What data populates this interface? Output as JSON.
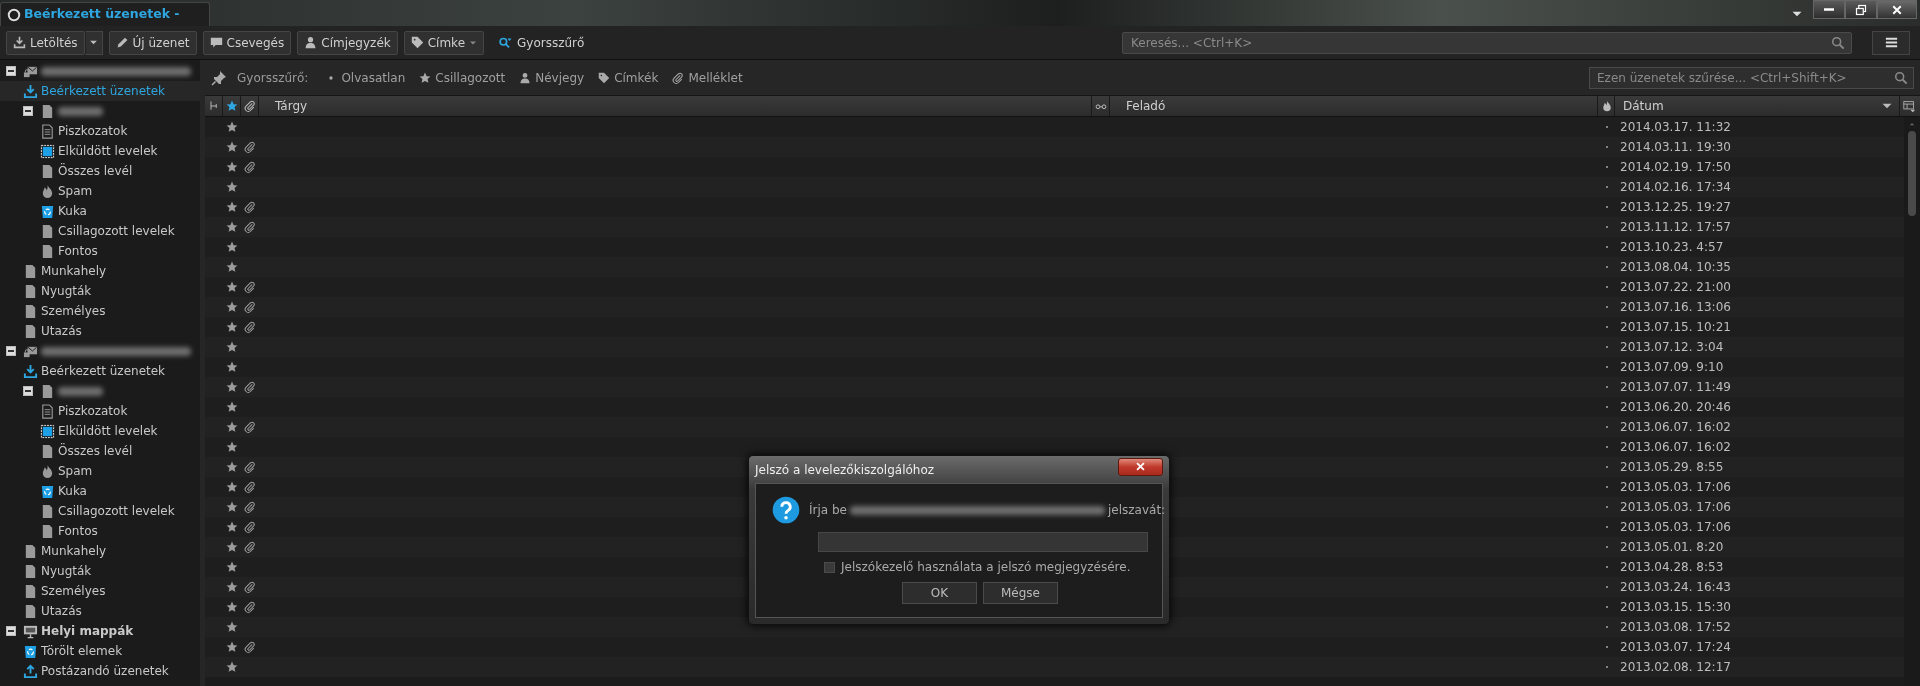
{
  "window": {
    "tab_title": "Beérkezett üzenetek -"
  },
  "toolbar": {
    "buttons": [
      {
        "label": "Letöltés",
        "kind": "split"
      },
      {
        "label": "Új üzenet",
        "kind": "button"
      },
      {
        "label": "Csevegés",
        "kind": "button"
      },
      {
        "label": "Címjegyzék",
        "kind": "button"
      },
      {
        "label": "Címke",
        "kind": "menu"
      },
      {
        "label": "Gyorsszűrő",
        "kind": "flat"
      }
    ],
    "search": {
      "placeholder": "Keresés... <Ctrl+K>"
    }
  },
  "folders": [
    {
      "kind": "account",
      "selected": false,
      "expanded": true,
      "children": [
        {
          "kind": "inbox",
          "label": "Beérkezett üzenetek",
          "selected": true
        },
        {
          "kind": "folder",
          "selected": false,
          "expanded": true,
          "children": [
            {
              "kind": "drafts",
              "label": "Piszkozatok",
              "selected": false
            },
            {
              "kind": "sent",
              "label": "Elküldött levelek",
              "selected": false
            },
            {
              "kind": "folder",
              "label": "Összes levél",
              "selected": false
            },
            {
              "kind": "spam",
              "label": "Spam",
              "selected": false
            },
            {
              "kind": "trash",
              "label": "Kuka",
              "selected": false
            },
            {
              "kind": "folder",
              "label": "Csillagozott levelek",
              "selected": false
            },
            {
              "kind": "folder",
              "label": "Fontos",
              "selected": false
            }
          ]
        },
        {
          "kind": "folder",
          "label": "Munkahely",
          "selected": false
        },
        {
          "kind": "folder",
          "label": "Nyugták",
          "selected": false
        },
        {
          "kind": "folder",
          "label": "Személyes",
          "selected": false
        },
        {
          "kind": "folder",
          "label": "Utazás",
          "selected": false
        }
      ]
    },
    {
      "kind": "account",
      "selected": false,
      "expanded": true,
      "children": [
        {
          "kind": "inbox",
          "label": "Beérkezett üzenetek",
          "selected": false
        },
        {
          "kind": "folder",
          "selected": false,
          "expanded": true,
          "children": [
            {
              "kind": "drafts",
              "label": "Piszkozatok",
              "selected": false
            },
            {
              "kind": "sent",
              "label": "Elküldött levelek",
              "selected": false
            },
            {
              "kind": "folder",
              "label": "Összes levél",
              "selected": false
            },
            {
              "kind": "spam",
              "label": "Spam",
              "selected": false
            },
            {
              "kind": "trash",
              "label": "Kuka",
              "selected": false
            },
            {
              "kind": "folder",
              "label": "Csillagozott levelek",
              "selected": false
            },
            {
              "kind": "folder",
              "label": "Fontos",
              "selected": false
            }
          ]
        },
        {
          "kind": "folder",
          "label": "Munkahely",
          "selected": false
        },
        {
          "kind": "folder",
          "label": "Nyugták",
          "selected": false
        },
        {
          "kind": "folder",
          "label": "Személyes",
          "selected": false
        },
        {
          "kind": "folder",
          "label": "Utazás",
          "selected": false
        }
      ]
    },
    {
      "kind": "local",
      "label": "Helyi mappák",
      "selected": false,
      "expanded": true,
      "children": [
        {
          "kind": "trash",
          "label": "Törölt elemek",
          "selected": false
        },
        {
          "kind": "outbox",
          "label": "Postázandó üzenetek",
          "selected": false
        }
      ]
    }
  ],
  "quick_filter": {
    "label": "Gyorsszűrő:",
    "items": [
      {
        "label": "Olvasatlan",
        "selected": false
      },
      {
        "label": "Csillagozott",
        "selected": false
      },
      {
        "label": "Névjegy",
        "selected": false
      },
      {
        "label": "Címkék",
        "selected": false
      },
      {
        "label": "Melléklet",
        "selected": false
      }
    ],
    "filter_field": {
      "placeholder": "Ezen üzenetek szűrése... <Ctrl+Shift+K>"
    }
  },
  "table": {
    "columns": [
      {
        "kind": "thread"
      },
      {
        "kind": "star"
      },
      {
        "kind": "attachment"
      },
      {
        "kind": "text",
        "label": "Tárgy",
        "sorted": false
      },
      {
        "kind": "read"
      },
      {
        "kind": "text",
        "label": "Feladó",
        "sorted": false
      },
      {
        "kind": "junk"
      },
      {
        "kind": "text",
        "label": "Dátum",
        "sorted": true
      }
    ],
    "rows": [
      {
        "starred": false,
        "attachment": false,
        "date": "2014.03.17. 11:32"
      },
      {
        "starred": false,
        "attachment": true,
        "date": "2014.03.11. 19:30"
      },
      {
        "starred": false,
        "attachment": true,
        "date": "2014.02.19. 17:50"
      },
      {
        "starred": false,
        "attachment": false,
        "date": "2014.02.16. 17:34"
      },
      {
        "starred": false,
        "attachment": true,
        "date": "2013.12.25. 19:27"
      },
      {
        "starred": false,
        "attachment": true,
        "date": "2013.11.12. 17:57"
      },
      {
        "starred": false,
        "attachment": false,
        "date": "2013.10.23. 4:57"
      },
      {
        "starred": false,
        "attachment": false,
        "date": "2013.08.04. 10:35"
      },
      {
        "starred": false,
        "attachment": true,
        "date": "2013.07.22. 21:00"
      },
      {
        "starred": false,
        "attachment": true,
        "date": "2013.07.16. 13:06"
      },
      {
        "starred": false,
        "attachment": true,
        "date": "2013.07.15. 10:21"
      },
      {
        "starred": false,
        "attachment": false,
        "date": "2013.07.12. 3:04"
      },
      {
        "starred": false,
        "attachment": false,
        "date": "2013.07.09. 9:10"
      },
      {
        "starred": false,
        "attachment": true,
        "date": "2013.07.07. 11:49"
      },
      {
        "starred": false,
        "attachment": false,
        "date": "2013.06.20. 20:46"
      },
      {
        "starred": false,
        "attachment": true,
        "date": "2013.06.07. 16:02"
      },
      {
        "starred": false,
        "attachment": false,
        "date": "2013.06.07. 16:02"
      },
      {
        "starred": false,
        "attachment": true,
        "date": "2013.05.29. 8:55"
      },
      {
        "starred": false,
        "attachment": true,
        "date": "2013.05.03. 17:06"
      },
      {
        "starred": false,
        "attachment": true,
        "date": "2013.05.03. 17:06"
      },
      {
        "starred": false,
        "attachment": true,
        "date": "2013.05.03. 17:06"
      },
      {
        "starred": false,
        "attachment": true,
        "date": "2013.05.01. 8:20"
      },
      {
        "starred": false,
        "attachment": false,
        "date": "2013.04.28. 8:53"
      },
      {
        "starred": false,
        "attachment": true,
        "date": "2013.03.24. 16:43"
      },
      {
        "starred": false,
        "attachment": true,
        "date": "2013.03.15. 15:30"
      },
      {
        "starred": false,
        "attachment": false,
        "date": "2013.03.08. 17:52"
      },
      {
        "starred": false,
        "attachment": true,
        "date": "2013.03.07. 17:24"
      },
      {
        "starred": false,
        "attachment": false,
        "date": "2013.02.08. 12:17"
      }
    ]
  },
  "dialog": {
    "title": "Jelszó a levelezőkiszolgálóhoz",
    "prompt_before": "Írja be",
    "prompt_after": "jelszavát:",
    "checkbox": {
      "label": "Jelszókezelő használata a jelszó megjegyzésére.",
      "checked": false
    },
    "buttons": [
      "OK",
      "Mégse"
    ]
  }
}
